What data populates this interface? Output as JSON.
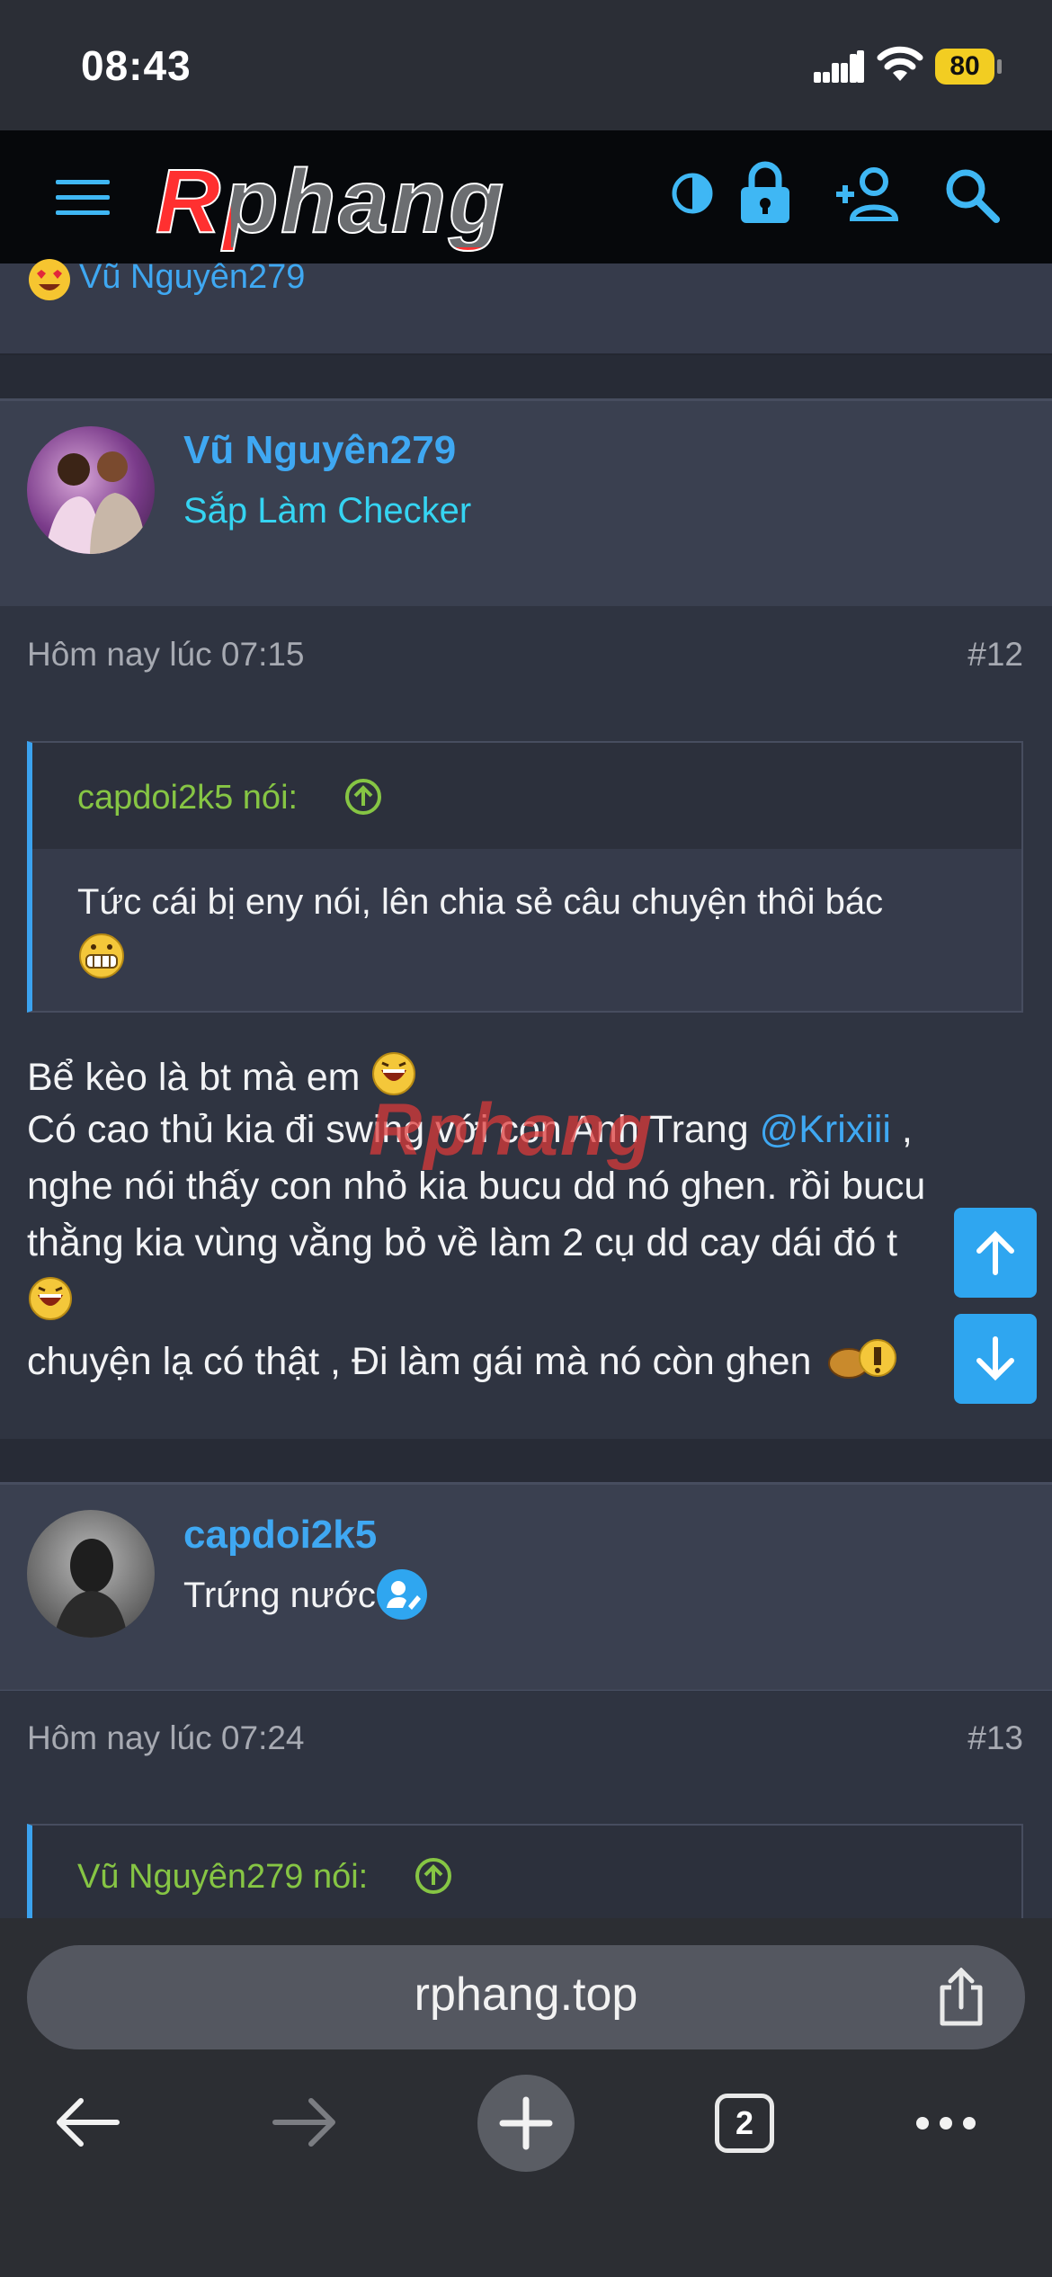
{
  "status_bar": {
    "time": "08:43",
    "battery": "80"
  },
  "site_header": {
    "logo_text": "Rphang"
  },
  "reaction_strip": {
    "user": "Vũ Nguyên279"
  },
  "posts": [
    {
      "username": "Vũ Nguyên279",
      "user_title": "Sắp Làm Checker",
      "user_title_color": "#35d4f2",
      "date": "Hôm nay lúc 07:15",
      "number": "#12",
      "quote": {
        "author": "capdoi2k5 nói:",
        "text_line1": "Tức cái bị eny nói, lên chia sẻ câu chuyện thôi bác"
      },
      "message": {
        "line1": "Bể kèo là bt mà em",
        "line2_before": "Có cao thủ kia đi swing với con Anh Trang ",
        "line2_mention": "@Krixiii",
        "line2_after": " ,",
        "line3": "nghe nói thấy con nhỏ kia bucu dd nó ghen. rồi bucu",
        "line4": "thằng kia vùng vằng bỏ về làm 2 cụ dd cay dái đó t",
        "line6": "chuyện lạ có thật , Đi làm gái mà nó còn ghen"
      }
    },
    {
      "username": "capdoi2k5",
      "user_title": "Trứng nước",
      "user_title_color": "#f2f3f5",
      "date": "Hôm nay lúc 07:24",
      "number": "#13",
      "quote": {
        "author": "Vũ Nguyên279 nói:"
      }
    }
  ],
  "watermark": "Rphang",
  "browser": {
    "url": "rphang.top",
    "tab_count": "2"
  },
  "colors": {
    "accent": "#3fa8f2",
    "quote_author": "#86c544",
    "background": "#2f3441"
  }
}
